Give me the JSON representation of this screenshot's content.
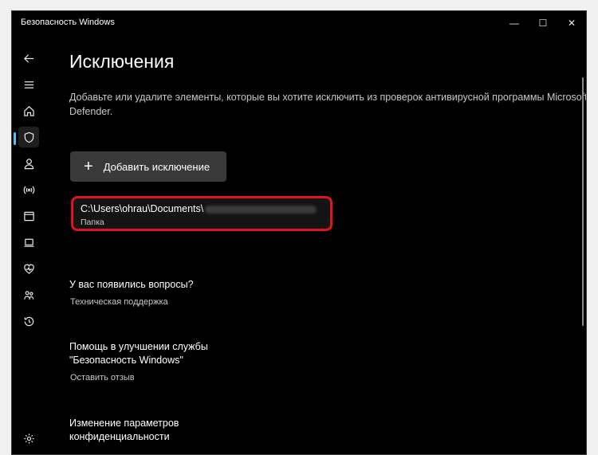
{
  "window": {
    "title": "Безопасность Windows",
    "controls": {
      "minimize": "—",
      "maximize": "☐",
      "close": "✕"
    }
  },
  "sidebar": {
    "items": [
      {
        "name": "back-icon"
      },
      {
        "name": "menu-icon"
      },
      {
        "name": "home-icon"
      },
      {
        "name": "shield-icon",
        "active": true
      },
      {
        "name": "account-icon"
      },
      {
        "name": "network-icon"
      },
      {
        "name": "app-browser-icon"
      },
      {
        "name": "device-security-icon"
      },
      {
        "name": "device-health-icon"
      },
      {
        "name": "family-icon"
      },
      {
        "name": "history-icon"
      },
      {
        "name": "settings-icon"
      }
    ]
  },
  "main": {
    "title": "Исключения",
    "description": "Добавьте или удалите элементы, которые вы хотите исключить из проверок антивирусной программы Microsoft Defender.",
    "add_button": {
      "icon": "+",
      "label": "Добавить исключение"
    },
    "exclusion": {
      "path": "C:\\Users\\ohrau\\Documents\\",
      "type": "Папка"
    },
    "sections": [
      {
        "title": "У вас появились вопросы?",
        "link": "Техническая поддержка"
      },
      {
        "title": "Помощь в улучшении службы\n\"Безопасность Windows\"",
        "link": "Оставить отзыв"
      },
      {
        "title": "Изменение параметров\nконфиденциальности",
        "link": ""
      }
    ]
  },
  "colors": {
    "background": "#000000",
    "highlight": "#e0141e",
    "button": "#3a3a3a",
    "accent": "#4cc2ff"
  }
}
